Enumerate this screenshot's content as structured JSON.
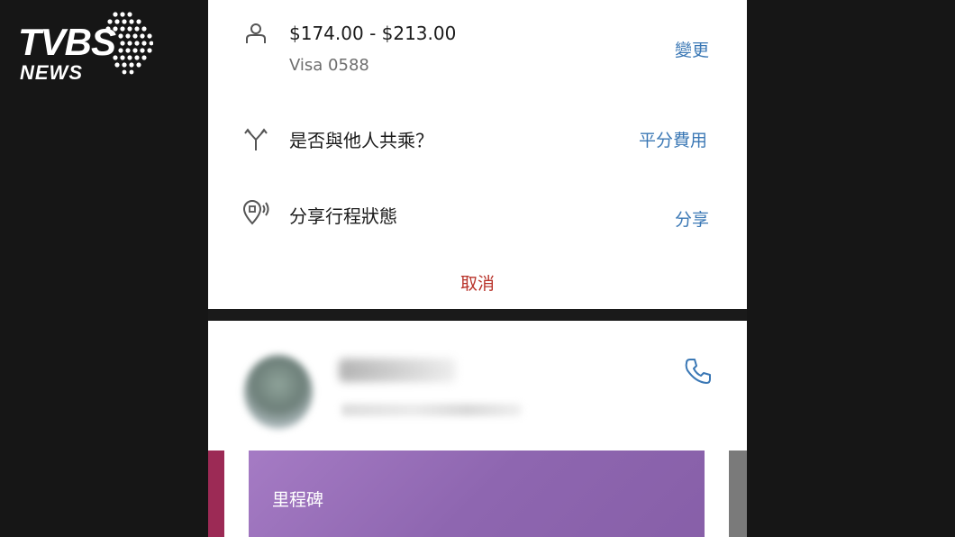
{
  "watermark": {
    "brand": "TVBS",
    "sub": "NEWS"
  },
  "payment": {
    "price_range": "$174.00 - $213.00",
    "card": "Visa 0588",
    "action": "變更",
    "icon": "person-icon"
  },
  "share_ride": {
    "label": "是否與他人共乘？",
    "action": "平分費用",
    "icon": "split-icon"
  },
  "share_status": {
    "label": "分享行程狀態",
    "action": "分享",
    "icon": "location-share-icon"
  },
  "cancel_label": "取消",
  "driver": {
    "call_icon": "phone-icon"
  },
  "milestone_card": {
    "title": "里程碑"
  },
  "colors": {
    "action_blue": "#3b78b5",
    "cancel_red": "#b83229",
    "card_purple": "#8e66b0"
  }
}
